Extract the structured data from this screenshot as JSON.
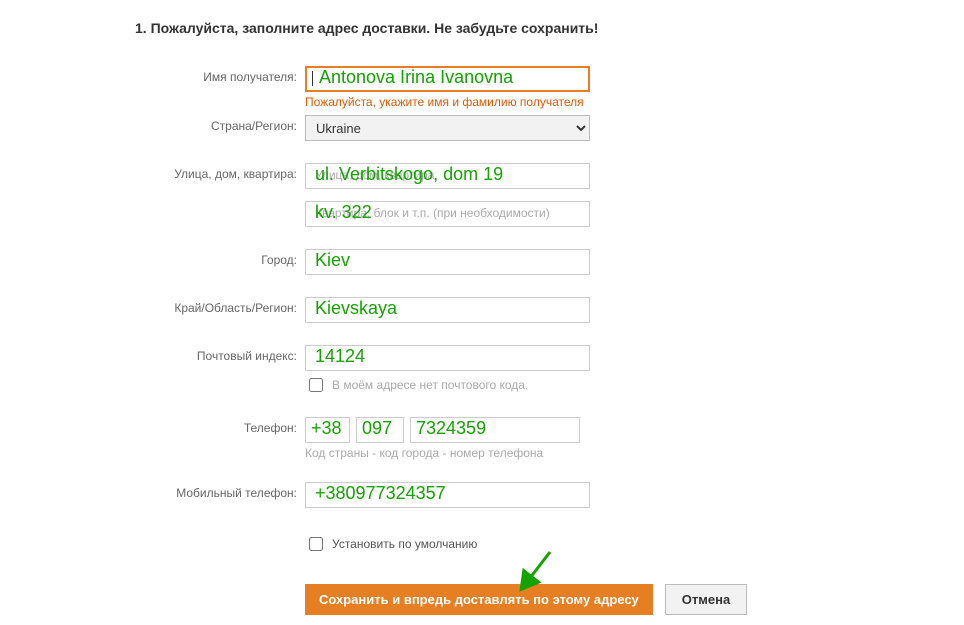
{
  "heading": "1. Пожалуйста, заполните адрес доставки. Не забудьте сохранить!",
  "labels": {
    "recipient": "Имя получателя:",
    "country": "Страна/Регион:",
    "street": "Улица, дом, квартира:",
    "city": "Город:",
    "region": "Край/Область/Регион:",
    "postcode": "Почтовый индекс:",
    "phone": "Телефон:",
    "mobile": "Мобильный телефон:"
  },
  "values": {
    "recipient": "Antonova Irina Ivanovna",
    "country": "Ukraine",
    "street1": "ul. Verbitskogo, dom 19",
    "street2": "kv. 322",
    "city": "Kiev",
    "region": "Kievskaya",
    "postcode": "14124",
    "phone_country": "+38",
    "phone_area": "097",
    "phone_number": "7324359",
    "mobile": "+380977324357"
  },
  "placeholders": {
    "street1": "Улица, дом, квартира",
    "street2": "Квартира, блок и т.п. (при необходимости)"
  },
  "messages": {
    "recipient_error": "Пожалуйста, укажите имя и фамилию получателя",
    "no_postcode": "В моём адресе нет почтового кода.",
    "phone_hint": "Код страны - код города - номер телефона",
    "set_default": "Установить по умолчанию"
  },
  "buttons": {
    "save": "Сохранить и впредь доставлять по этому адресу",
    "cancel": "Отмена"
  },
  "colors": {
    "accent": "#e67e22",
    "overlay_green": "#14a300"
  }
}
